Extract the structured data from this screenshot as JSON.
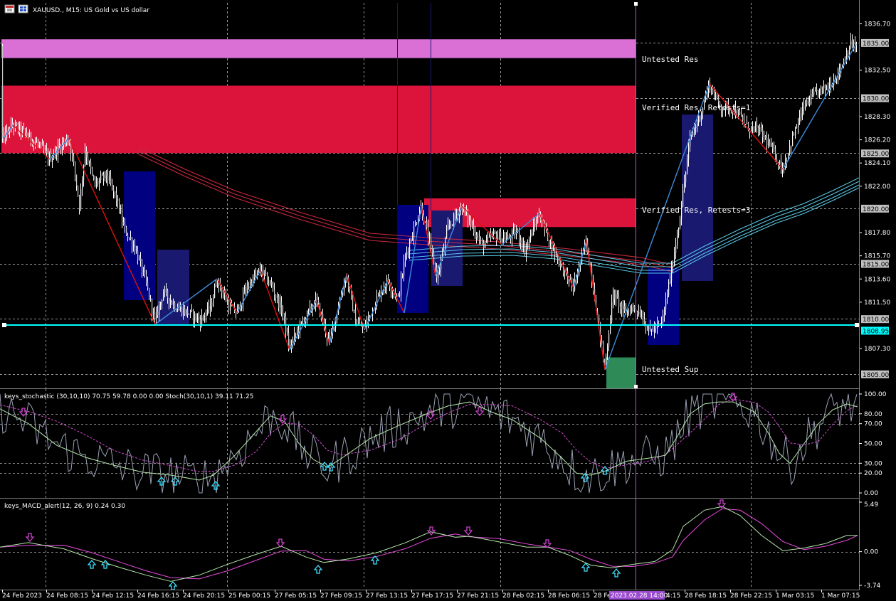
{
  "window": {
    "title": "XAUUSD., M15: US Gold vs US dollar",
    "icons": [
      "chart-window-icon",
      "menu-grid-icon"
    ]
  },
  "colors": {
    "background": "#000000",
    "grid": "#b4b4b4",
    "candle_up": "#ffffff",
    "candle_down": "#ffffff",
    "zone_untested_res": "#da70d6",
    "zone_verified_res": "#dc143c",
    "zone_untested_sup": "#2e8b57",
    "box_blue": "#000080",
    "box_slate": "#191970",
    "zigzag_up": "#3c8cdc",
    "zigzag_down": "#e01010",
    "ma_red": "#c8283c",
    "ma_cyan": "#5ac8e6",
    "hline_cyan": "#00ffff",
    "vline_magenta": "#c050e0",
    "stoch_main": "#b4e6aa",
    "stoch_signal": "#d24cd2",
    "stoch_raw": "#9aa0b4",
    "macd_main": "#b4e6aa",
    "macd_signal": "#e64cdc",
    "arrow_up": "#40e0ff",
    "arrow_down": "#d040d0"
  },
  "main_panel": {
    "zones": [
      {
        "label": "Untested Res",
        "color_key": "zone_untested_res",
        "price_top": 1835.3,
        "price_bottom": 1833.6,
        "start_index": 0,
        "end_index": 893
      },
      {
        "label": "Verified Res, Retests=1",
        "color_key": "zone_verified_res",
        "price_top": 1831.1,
        "price_bottom": 1825.0,
        "start_index": 0,
        "end_index": 893
      },
      {
        "label": "Verified Res, Retests=3",
        "color_key": "zone_verified_res",
        "price_top": 1820.9,
        "price_bottom": 1818.3,
        "start_index": 594,
        "end_index": 893
      },
      {
        "label": "Untested Sup",
        "color_key": "zone_untested_sup",
        "price_top": 1806.5,
        "price_bottom": 1803.7,
        "start_index": 850,
        "end_index": 893
      }
    ],
    "price_axis": {
      "ticks": [
        "1836.70",
        "1832.50",
        "1828.30",
        "1826.20",
        "1824.10",
        "1822.00",
        "1817.80",
        "1815.70",
        "1813.60",
        "1811.50",
        "1807.30"
      ],
      "levels": [
        "1835.00",
        "1830.00",
        "1825.00",
        "1820.00",
        "1815.00",
        "1810.00",
        "1805.00"
      ],
      "current": "1808.95",
      "ymin": 1803.7,
      "ymax": 1838.6
    },
    "current_price": 1808.95
  },
  "stochastic": {
    "header": "keys_stochastic (30,10,10) 70.75 59.78 0.00 0.00 Stoch(30,10,1) 39.11 71.25",
    "ticks": [
      "100.00",
      "80.00",
      "70.00",
      "50.00",
      "30.00",
      "20.00",
      "0.00"
    ],
    "ymin": -5,
    "ymax": 105
  },
  "macd": {
    "header": "keys_MACD_alert(12, 26, 9) 0.24 0.30",
    "ticks": [
      "5.49",
      "0.00",
      "-3.74"
    ],
    "ymin": -3.74,
    "ymax": 5.49
  },
  "time_axis": {
    "labels": [
      "24 Feb 2023",
      "24 Feb 08:15",
      "24 Feb 12:15",
      "24 Feb 16:15",
      "24 Feb 20:15",
      "25 Feb 00:15",
      "27 Feb 05:15",
      "27 Feb 09:15",
      "27 Feb 13:15",
      "27 Feb 17:15",
      "27 Feb 21:15",
      "28 Feb 02:15",
      "28 Feb 06:15",
      "28 Fe",
      "28 Feb 18:15",
      "28 Feb 22:15",
      "1 Mar 03:15",
      "1 Mar 07:15"
    ],
    "cursor_label": "2023.02.28 14:00",
    "cursor_suffix": "4:15"
  },
  "chart_data": {
    "type": "candlestick",
    "symbol": "XAUUSD.",
    "timeframe": "M15",
    "price_path": [
      {
        "time": "24 Feb 2023",
        "price": 1824.5
      },
      {
        "time": "24 Feb 08:15",
        "price": 1824.8
      },
      {
        "time": "24 Feb 12:15",
        "price": 1820.4
      },
      {
        "time": "24 Feb 16:15",
        "price": 1810.1
      },
      {
        "time": "24 Feb 20:15",
        "price": 1811.1
      },
      {
        "time": "25 Feb 00:15",
        "price": 1813.5
      },
      {
        "time": "27 Feb 05:15",
        "price": 1807.9
      },
      {
        "time": "27 Feb 09:15",
        "price": 1812.9
      },
      {
        "time": "27 Feb 13:15",
        "price": 1811.0
      },
      {
        "time": "27 Feb 17:15",
        "price": 1819.6
      },
      {
        "time": "27 Feb 21:15",
        "price": 1817.0
      },
      {
        "time": "28 Feb 02:15",
        "price": 1817.6
      },
      {
        "time": "28 Feb 06:15",
        "price": 1813.0
      },
      {
        "time": "28 Fe",
        "price": 1808.9
      },
      {
        "time": "28 Feb 18:15",
        "price": 1829.0
      },
      {
        "time": "28 Feb 22:15",
        "price": 1826.0
      },
      {
        "time": "1 Mar 03:15",
        "price": 1827.4
      },
      {
        "time": "1 Mar 07:15",
        "price": 1833.5
      }
    ],
    "ylim": [
      1803.7,
      1838.6
    ],
    "stochastic_ylim": [
      0,
      100
    ],
    "macd_ylim": [
      -3.74,
      5.49
    ]
  }
}
